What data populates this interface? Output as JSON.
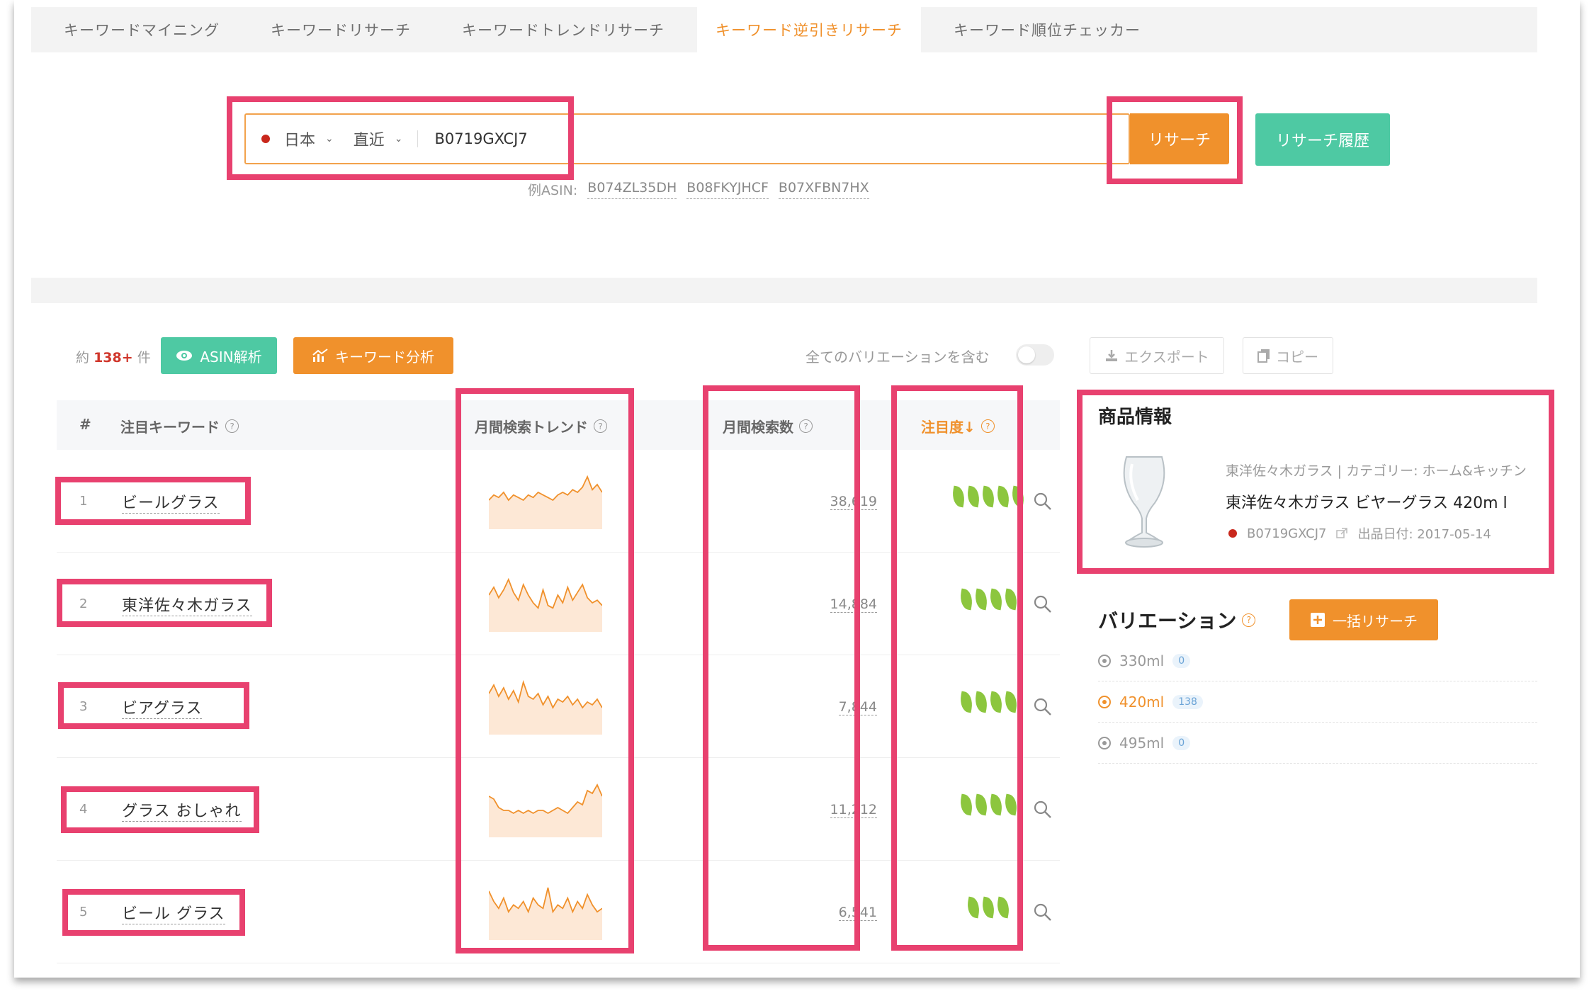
{
  "tabs": [
    {
      "label": "キーワードマイニング",
      "active": false
    },
    {
      "label": "キーワードリサーチ",
      "active": false
    },
    {
      "label": "キーワードトレンドリサーチ",
      "active": false
    },
    {
      "label": "キーワード逆引きリサーチ",
      "active": true
    },
    {
      "label": "キーワード順位チェッカー",
      "active": false
    }
  ],
  "search": {
    "marketplace": "日本",
    "period": "直近",
    "asin_value": "B0719GXCJ7",
    "submit_label": "リサーチ",
    "history_label": "リサーチ履歴",
    "examples_label": "例ASIN:",
    "examples": [
      "B074ZL35DH",
      "B08FKYJHCF",
      "B07XFBN7HX"
    ]
  },
  "toolbar": {
    "count_prefix": "約",
    "count_value": "138+",
    "count_suffix": "件",
    "asin_analysis_label": "ASIN解析",
    "keyword_analysis_label": "キーワード分析",
    "include_variations_label": "全てのバリエーションを含む",
    "export_label": "エクスポート",
    "copy_label": "コピー"
  },
  "table": {
    "headers": {
      "rank": "#",
      "keyword": "注目キーワード",
      "trend": "月間検索トレンド",
      "volume": "月間検索数",
      "attention": "注目度↓"
    },
    "rows": [
      {
        "rank": "1",
        "keyword": "ビールグラス",
        "volume": "38,619",
        "attention": 5,
        "trend": [
          3,
          5,
          4,
          6,
          3,
          5,
          4,
          3,
          5,
          4,
          6,
          5,
          4,
          3,
          5,
          6,
          5,
          7,
          6,
          8,
          12,
          7,
          9,
          6
        ]
      },
      {
        "rank": "2",
        "keyword": "東洋佐々木ガラス",
        "volume": "14,884",
        "attention": 4,
        "trend": [
          6,
          9,
          5,
          8,
          12,
          7,
          4,
          10,
          6,
          3,
          1,
          8,
          2,
          1,
          6,
          3,
          9,
          4,
          7,
          10,
          5,
          3,
          4,
          2
        ]
      },
      {
        "rank": "3",
        "keyword": "ビアグラス",
        "volume": "7,844",
        "attention": 4,
        "trend": [
          7,
          10,
          6,
          9,
          5,
          8,
          4,
          11,
          6,
          5,
          7,
          3,
          6,
          2,
          5,
          4,
          6,
          3,
          5,
          2,
          4,
          3,
          5,
          2
        ]
      },
      {
        "rank": "4",
        "keyword": "グラス おしゃれ",
        "volume": "11,212",
        "attention": 4,
        "trend": [
          7,
          6,
          3,
          2,
          2,
          1,
          2,
          1,
          2,
          1,
          2,
          2,
          1,
          2,
          3,
          2,
          1,
          3,
          5,
          4,
          9,
          8,
          11,
          7
        ]
      },
      {
        "rank": "5",
        "keyword": "ビール グラス",
        "volume": "6,541",
        "attention": 3,
        "trend": [
          8,
          5,
          3,
          6,
          2,
          4,
          3,
          5,
          2,
          6,
          4,
          3,
          9,
          2,
          4,
          3,
          6,
          2,
          5,
          3,
          7,
          4,
          2,
          3
        ]
      }
    ]
  },
  "product": {
    "section_title": "商品情報",
    "meta": "東洋佐々木ガラス | カテゴリー: ホーム&キッチン",
    "name": "東洋佐々木ガラス ビヤーグラス 420m l",
    "asin": "B0719GXCJ7",
    "listing_date": "出品日付: 2017-05-14"
  },
  "variations": {
    "title": "バリエーション",
    "bulk_label": "一括リサーチ",
    "items": [
      {
        "label": "330ml",
        "count": "0",
        "active": false
      },
      {
        "label": "420ml",
        "count": "138",
        "active": true
      },
      {
        "label": "495ml",
        "count": "0",
        "active": false
      }
    ]
  },
  "colors": {
    "accent": "#f0912c",
    "teal": "#4ec9a3",
    "annotation": "#e8416f",
    "leaf": "#8cc63e"
  }
}
